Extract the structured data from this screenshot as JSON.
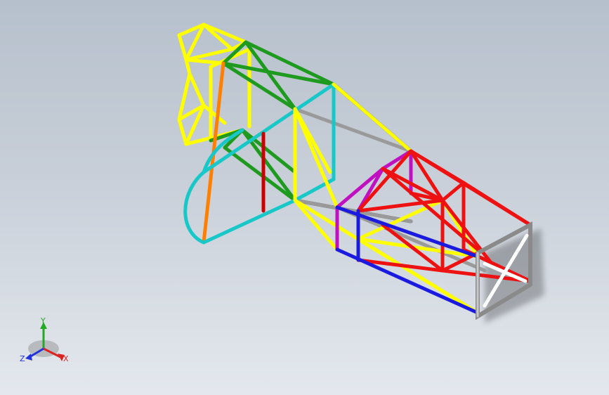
{
  "triad": {
    "y_label": "Y",
    "x_label": "X",
    "z_label": "Z",
    "colors": {
      "x": "#dd2222",
      "y": "#22aa22",
      "z": "#2233dd"
    }
  },
  "frame": {
    "member_colors": {
      "yellow": "#ffff00",
      "green": "#1e9a1e",
      "orange": "#ff7f00",
      "cyan": "#18c7c7",
      "red": "#ee1111",
      "black": "#111111",
      "grey": "#9a9a9a",
      "magenta": "#c010c0",
      "blue": "#1a1ae0",
      "white": "#ffffff",
      "steel": "#a8a8a8"
    }
  }
}
